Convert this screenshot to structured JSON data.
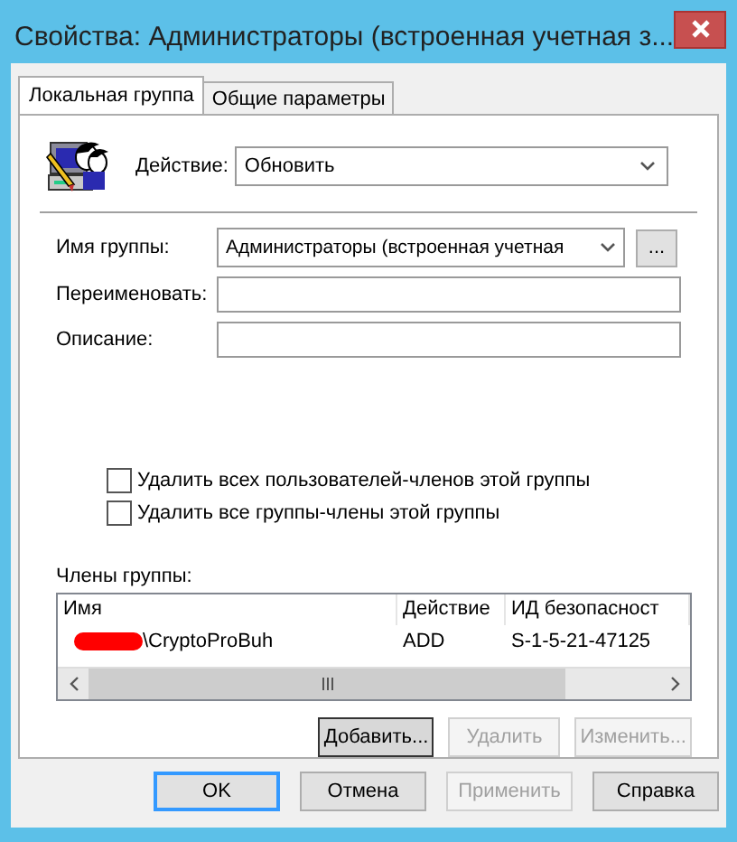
{
  "window": {
    "title": "Свойства: Администраторы (встроенная учетная з..."
  },
  "tabs": [
    {
      "label": "Локальная группа",
      "selected": true
    },
    {
      "label": "Общие параметры",
      "selected": false
    }
  ],
  "action": {
    "label": "Действие:",
    "value": "Обновить"
  },
  "group_name": {
    "label": "Имя группы:",
    "value": "Администраторы (встроенная учетная",
    "browse": "..."
  },
  "rename": {
    "label": "Переименовать:"
  },
  "description": {
    "label": "Описание:"
  },
  "checkboxes": [
    {
      "label": "Удалить всех пользователей-членов этой группы",
      "checked": false
    },
    {
      "label": "Удалить все группы-члены этой группы",
      "checked": false
    }
  ],
  "members": {
    "label": "Члены группы:",
    "columns": [
      "Имя",
      "Действие",
      "ИД безопасност"
    ],
    "rows": [
      {
        "cells": [
          "\\CryptoProBuh",
          "ADD",
          "S-1-5-21-47125"
        ],
        "redacted": true
      }
    ]
  },
  "member_buttons": [
    {
      "label": "Добавить...",
      "disabled": false,
      "focused": true
    },
    {
      "label": "Удалить",
      "disabled": true,
      "focused": false
    },
    {
      "label": "Изменить...",
      "disabled": true,
      "focused": false
    }
  ],
  "dialog_buttons": [
    {
      "label": "OK",
      "disabled": false,
      "default": true
    },
    {
      "label": "Отмена",
      "disabled": false,
      "default": false
    },
    {
      "label": "Применить",
      "disabled": true,
      "default": false
    },
    {
      "label": "Справка",
      "disabled": false,
      "default": false
    }
  ]
}
